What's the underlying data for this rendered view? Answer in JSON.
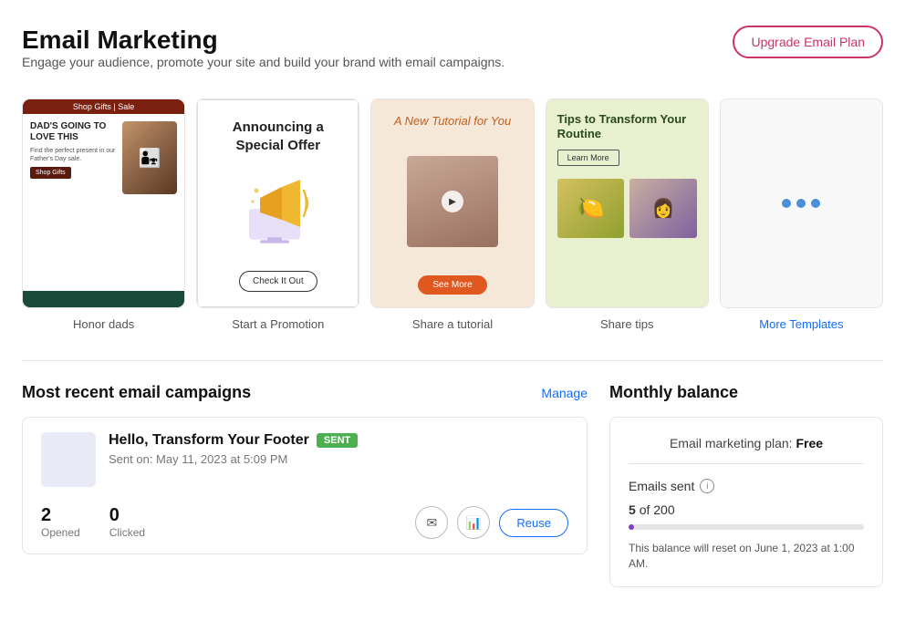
{
  "header": {
    "title": "Email Marketing",
    "subtitle": "Engage your audience, promote your site and build your brand with email campaigns.",
    "upgrade_btn": "Upgrade Email Plan"
  },
  "templates": [
    {
      "id": "honor-dads",
      "label": "Honor dads",
      "type": "dad",
      "top_text": "Shop Gifts | Sale",
      "headline": "DAD'S GOING TO LOVE THIS",
      "body": "Find the perfect present in our Father's Day sale.",
      "btn": "Shop Gifts"
    },
    {
      "id": "start-promotion",
      "label": "Start a Promotion",
      "type": "promo",
      "title": "Announcing a Special Offer",
      "btn": "Check It Out"
    },
    {
      "id": "share-tutorial",
      "label": "Share a tutorial",
      "type": "tutorial",
      "title": "A New Tutorial for You",
      "btn": "See More"
    },
    {
      "id": "share-tips",
      "label": "Share tips",
      "type": "tips",
      "title": "Tips to Transform Your Routine",
      "btn": "Learn More"
    },
    {
      "id": "more-templates",
      "label": "More Templates",
      "type": "more"
    }
  ],
  "campaigns_section": {
    "title": "Most recent email campaigns",
    "manage_label": "Manage"
  },
  "campaign": {
    "title": "Hello, Transform Your Footer",
    "status": "SENT",
    "date": "Sent on: May 11, 2023 at 5:09 PM",
    "stats": [
      {
        "number": "2",
        "label": "Opened"
      },
      {
        "number": "0",
        "label": "Clicked"
      }
    ],
    "actions": {
      "reuse": "Reuse"
    }
  },
  "balance_section": {
    "title": "Monthly balance",
    "plan_label": "Email marketing plan:",
    "plan_name": "Free",
    "emails_sent_label": "Emails sent",
    "count_used": "5",
    "count_total": "200",
    "count_display": "5 of 200",
    "progress_pct": 2.5,
    "note": "This balance will reset on June 1, 2023 at 1:00 AM."
  },
  "icons": {
    "envelope": "✉",
    "bar_chart": "📊",
    "info": "i",
    "dots": "•••"
  }
}
